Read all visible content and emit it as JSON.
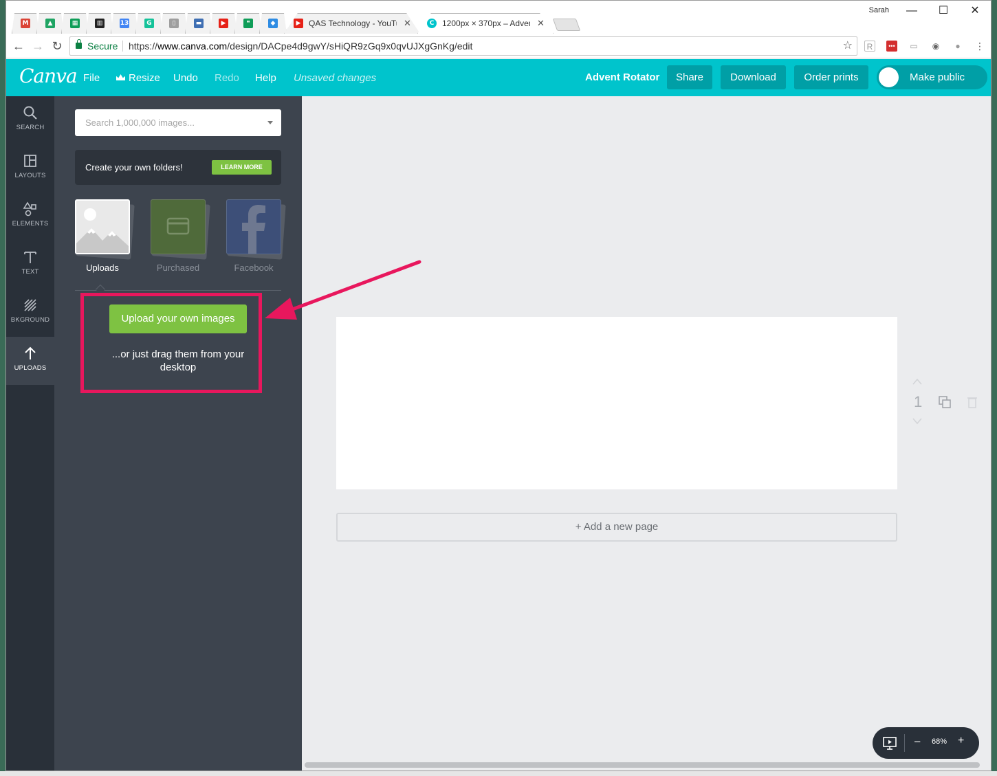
{
  "browser": {
    "user": "Sarah",
    "tabs": [
      {
        "icon": "gmail-icon",
        "color": "#db4437",
        "glyph": "M"
      },
      {
        "icon": "drive-icon",
        "color": "#1fa463",
        "glyph": "▲"
      },
      {
        "icon": "sheets-icon",
        "color": "#0f9d58",
        "glyph": "▦"
      },
      {
        "icon": "trello-icon",
        "color": "#222222",
        "glyph": "▥"
      },
      {
        "icon": "calendar-icon",
        "color": "#4285f4",
        "glyph": "13"
      },
      {
        "icon": "grammarly-icon",
        "color": "#15c39a",
        "glyph": "G"
      },
      {
        "icon": "document-icon",
        "color": "#9e9e9e",
        "glyph": "▯"
      },
      {
        "icon": "inbox-icon",
        "color": "#3f6fb3",
        "glyph": "▬"
      },
      {
        "icon": "youtube-icon",
        "color": "#e62117",
        "glyph": "▶"
      },
      {
        "icon": "hangouts-icon",
        "color": "#0f9d58",
        "glyph": "❝"
      },
      {
        "icon": "dropbox-icon",
        "color": "#2e8ce3",
        "glyph": "◆"
      }
    ],
    "tab_youtube": {
      "title": "QAS Technology - YouTu"
    },
    "tab_canva": {
      "title": "1200px × 370px – Adven"
    },
    "address": {
      "secure_label": "Secure",
      "url_scheme": "https://",
      "url_host": "www.canva.com",
      "url_path": "/design/DACpe4d9gwY/sHiQR9zGq9x0qvUJXgGnKg/edit"
    }
  },
  "canva": {
    "logo": "Canva",
    "menu": {
      "file": "File",
      "resize": "Resize",
      "undo": "Undo",
      "redo": "Redo",
      "help": "Help",
      "status": "Unsaved changes"
    },
    "design_title": "Advent Rotator",
    "buttons": {
      "share": "Share",
      "download": "Download",
      "order_prints": "Order prints",
      "make_public": "Make public"
    },
    "sidebar": [
      {
        "label": "SEARCH",
        "icon": "search-icon"
      },
      {
        "label": "LAYOUTS",
        "icon": "layouts-icon"
      },
      {
        "label": "ELEMENTS",
        "icon": "elements-icon"
      },
      {
        "label": "TEXT",
        "icon": "text-icon"
      },
      {
        "label": "BKGROUND",
        "icon": "background-icon"
      },
      {
        "label": "UPLOADS",
        "icon": "upload-arrow-icon"
      }
    ],
    "panel": {
      "search_placeholder": "Search 1,000,000 images...",
      "promo_text": "Create your own folders!",
      "learn_more": "LEARN MORE",
      "folders": [
        {
          "label": "Uploads"
        },
        {
          "label": "Purchased"
        },
        {
          "label": "Facebook"
        }
      ],
      "upload_button": "Upload your own images",
      "drag_text": "...or just drag them from your desktop"
    },
    "canvas": {
      "page_number": "1",
      "add_page": "+ Add a new page",
      "zoom_minus": "–",
      "zoom_level": "68%",
      "zoom_plus": "+"
    }
  },
  "colors": {
    "brand": "#00c4cc",
    "button_dark": "#009fa6",
    "accent_green": "#7ec242",
    "highlight": "#e8175d"
  }
}
